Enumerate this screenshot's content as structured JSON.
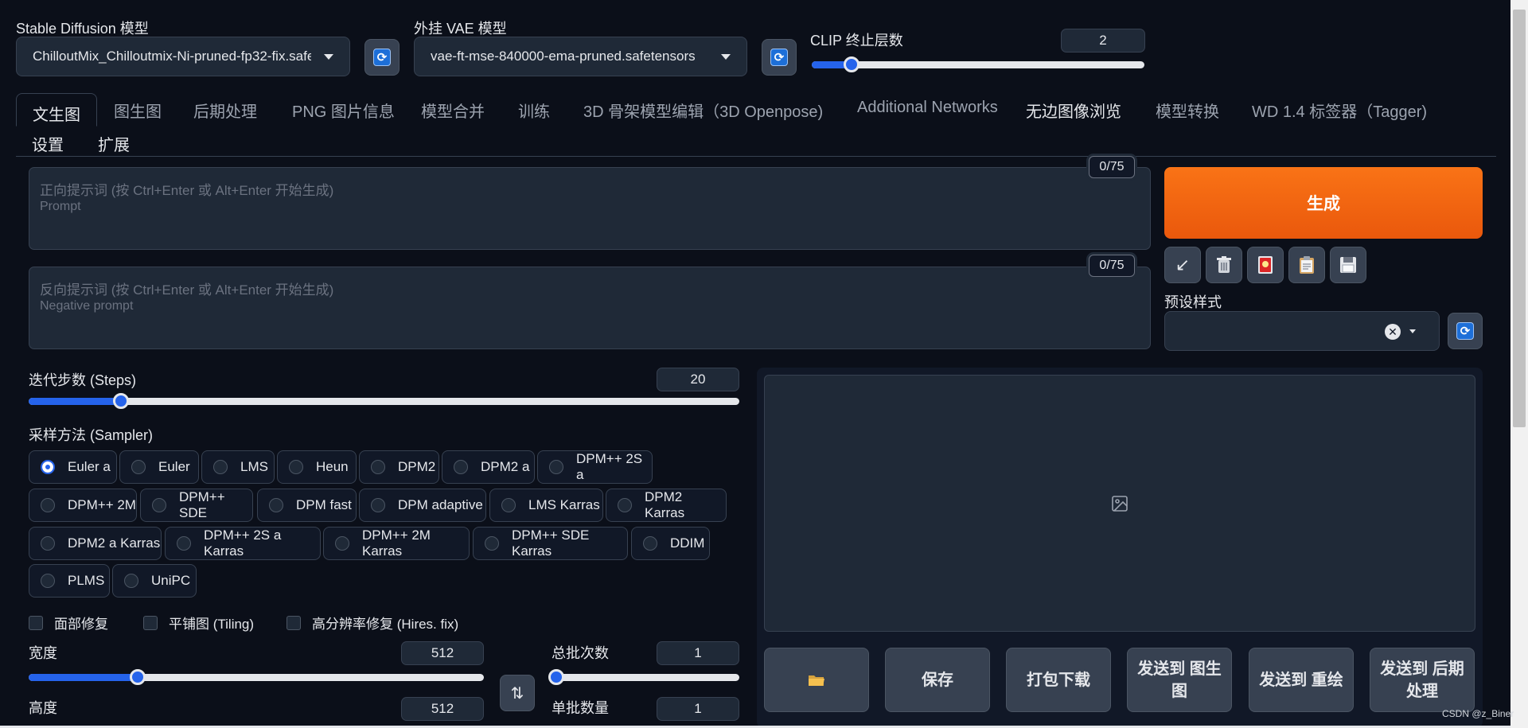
{
  "top": {
    "sd_model_label": "Stable Diffusion 模型",
    "sd_model_value": "ChilloutMix_Chilloutmix-Ni-pruned-fp32-fix.safe",
    "vae_label": "外挂 VAE 模型",
    "vae_value": "vae-ft-mse-840000-ema-pruned.safetensors",
    "clip_label": "CLIP 终止层数",
    "clip_value": "2",
    "clip_slider_fraction": 0.12
  },
  "tabs": [
    {
      "label": "文生图",
      "selected": true
    },
    {
      "label": "图生图"
    },
    {
      "label": "后期处理"
    },
    {
      "label": "PNG 图片信息"
    },
    {
      "label": "模型合并"
    },
    {
      "label": "训练"
    },
    {
      "label": "3D 骨架模型编辑（3D Openpose)"
    },
    {
      "label": "Additional Networks"
    },
    {
      "label": "无边图像浏览"
    },
    {
      "label": "模型转换"
    },
    {
      "label": "WD 1.4 标签器（Tagger)"
    },
    {
      "label": "设置"
    },
    {
      "label": "扩展"
    }
  ],
  "prompt": {
    "placeholder_line1": "正向提示词 (按 Ctrl+Enter 或 Alt+Enter 开始生成)",
    "placeholder_line2": "Prompt",
    "counter": "0/75"
  },
  "negative_prompt": {
    "placeholder_line1": "反向提示词 (按 Ctrl+Enter 或 Alt+Enter 开始生成)",
    "placeholder_line2": "Negative prompt",
    "counter": "0/75"
  },
  "generate_label": "生成",
  "tool_icons": [
    "arrow-icon",
    "trash-icon",
    "card-icon",
    "clipboard-icon",
    "save-icon"
  ],
  "styles_label": "预设样式",
  "steps": {
    "label": "迭代步数 (Steps)",
    "value": "20",
    "slider_fraction": 0.13
  },
  "sampler": {
    "label": "采样方法 (Sampler)",
    "selected": "Euler a",
    "options": [
      "Euler a",
      "Euler",
      "LMS",
      "Heun",
      "DPM2",
      "DPM2 a",
      "DPM++ 2S a",
      "DPM++ 2M",
      "DPM++ SDE",
      "DPM fast",
      "DPM adaptive",
      "LMS Karras",
      "DPM2 Karras",
      "DPM2 a Karras",
      "DPM++ 2S a Karras",
      "DPM++ 2M Karras",
      "DPM++ SDE Karras",
      "DDIM",
      "PLMS",
      "UniPC"
    ]
  },
  "checkboxes": [
    "面部修复",
    "平铺图 (Tiling)",
    "高分辨率修复 (Hires. fix)"
  ],
  "width": {
    "label": "宽度",
    "value": "512",
    "slider_fraction": 0.24
  },
  "height": {
    "label": "高度",
    "value": "512"
  },
  "batch_count": {
    "label": "总批次数",
    "value": "1",
    "slider_fraction": 0.0
  },
  "batch_size": {
    "label": "单批数量",
    "value": "1"
  },
  "actions": [
    "保存",
    "打包下载",
    "发送到 图生图",
    "发送到 重绘",
    "发送到 后期处理"
  ],
  "watermark": "CSDN @z_Biner",
  "colors": {
    "accent": "#2563eb",
    "generate": "#ea580c",
    "background": "#0b0f19"
  }
}
